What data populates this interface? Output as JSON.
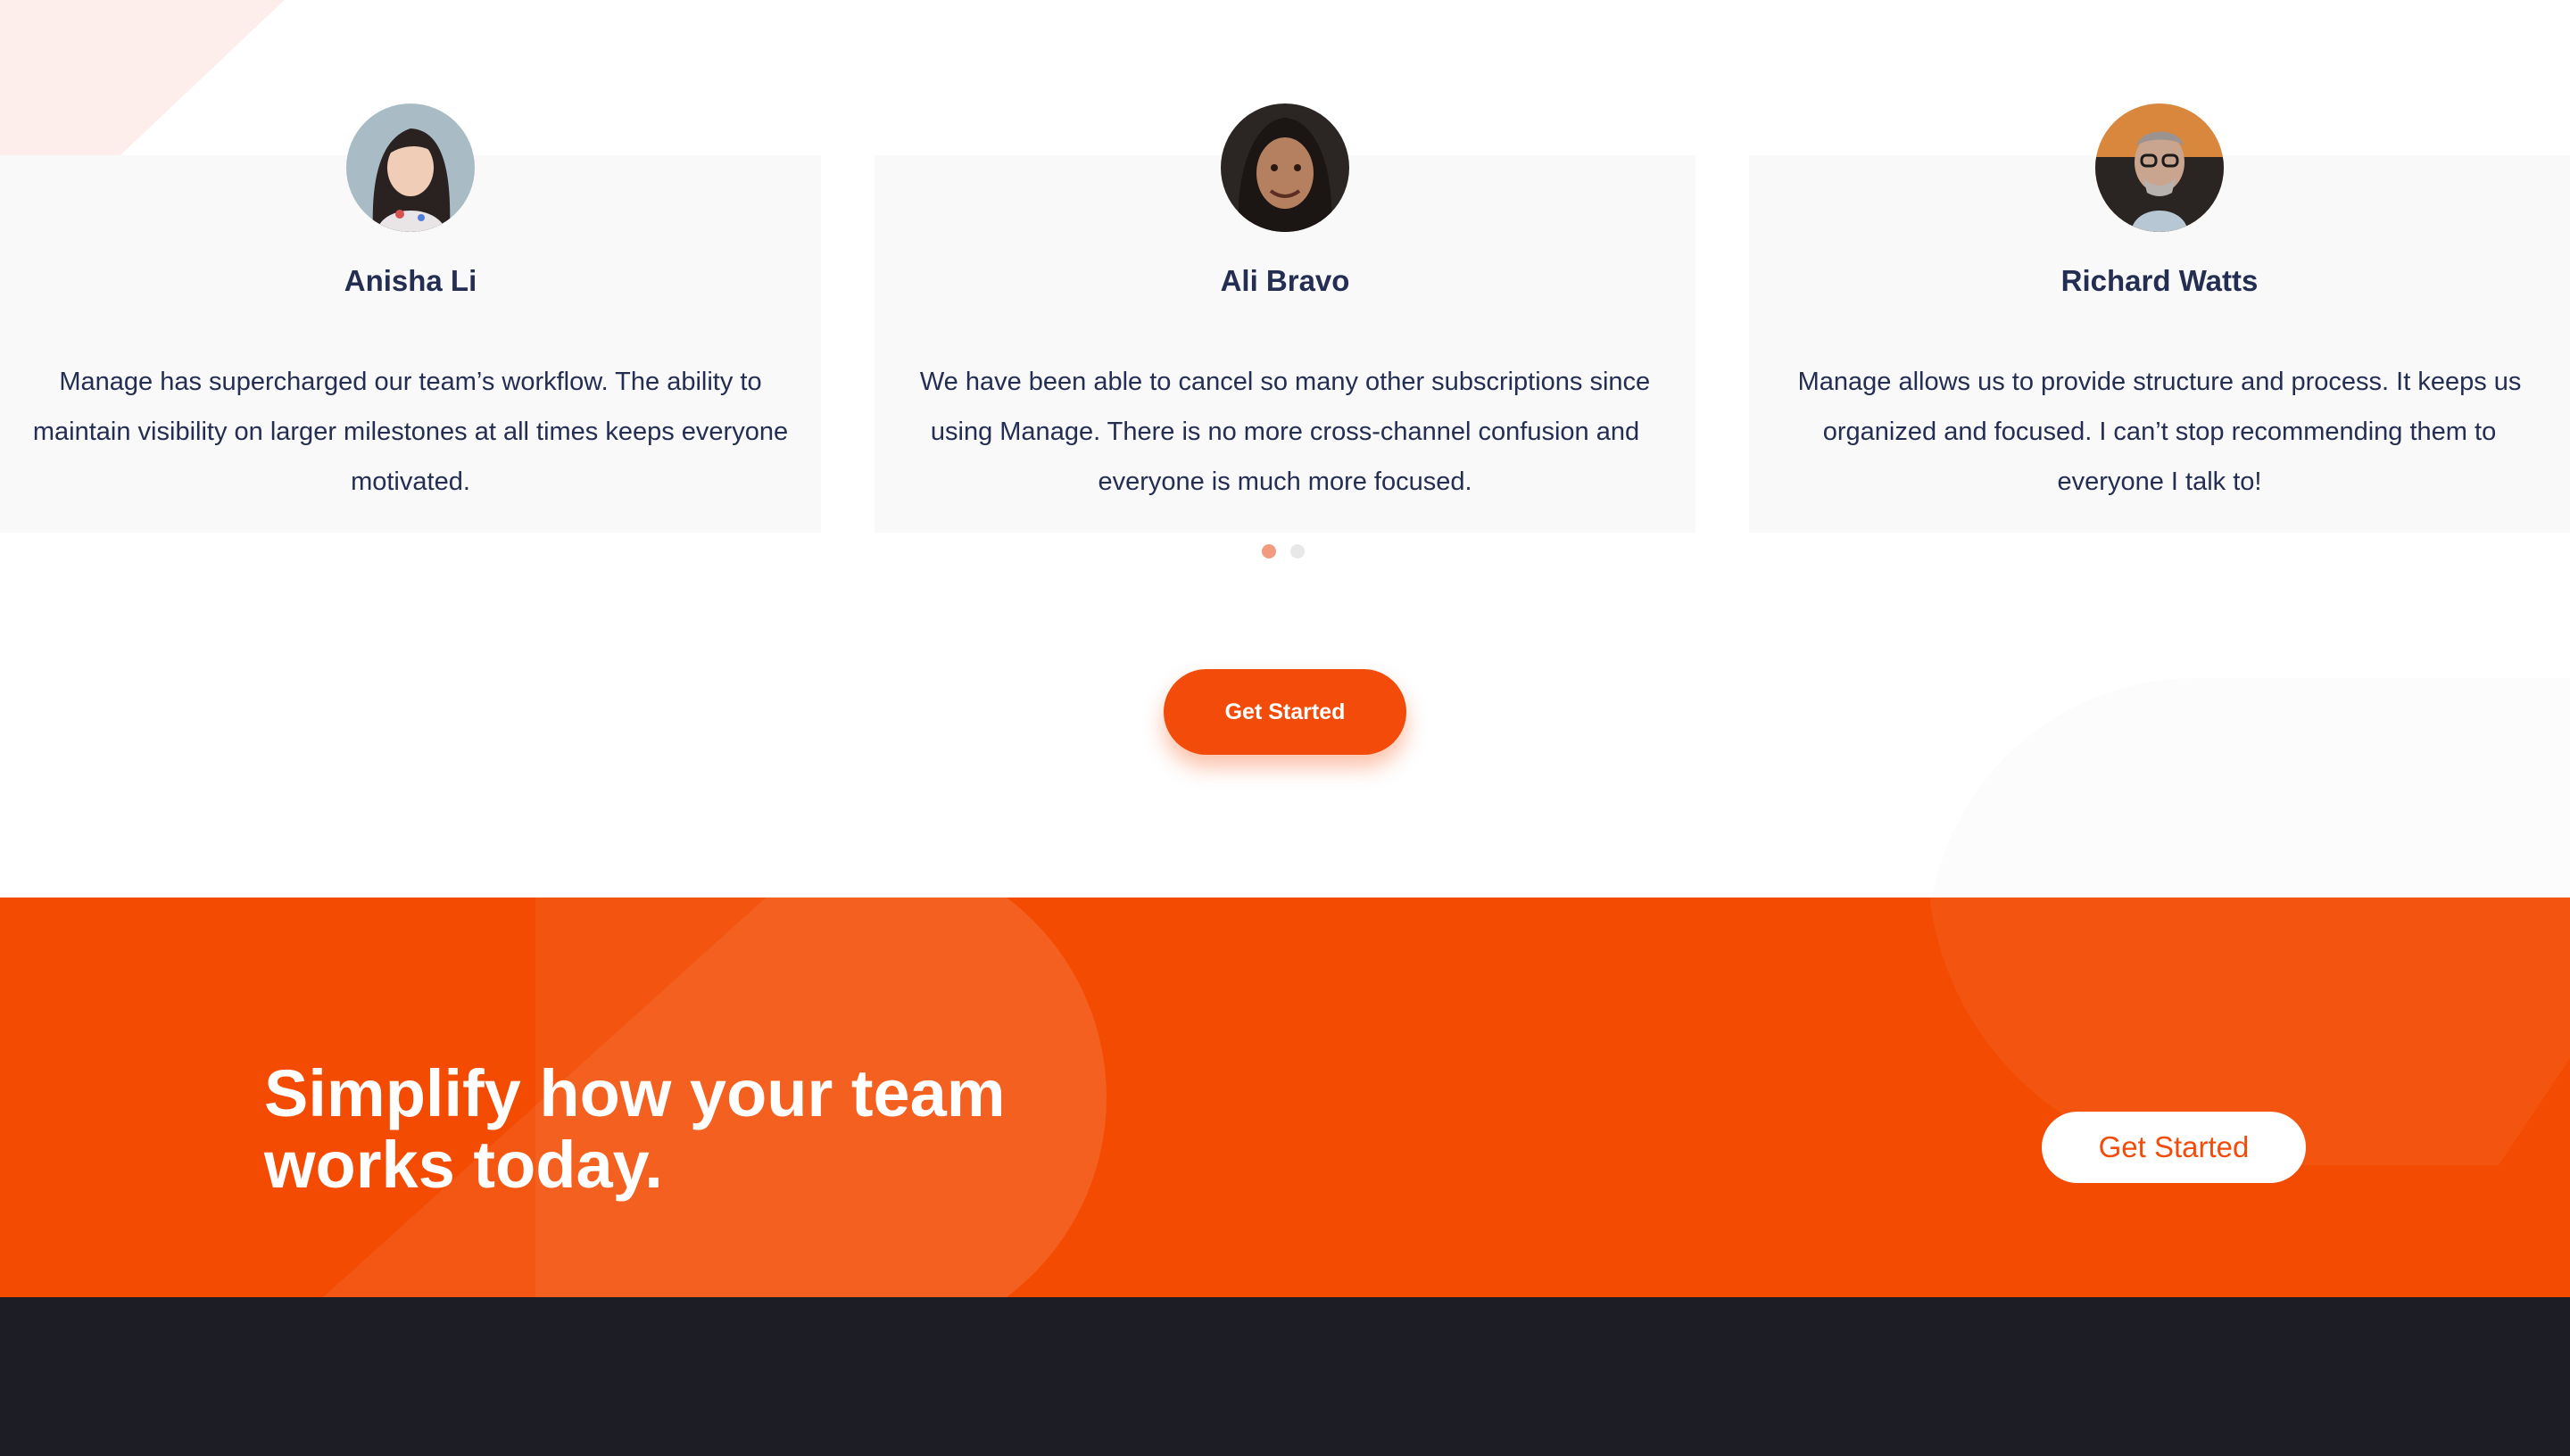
{
  "testimonials": [
    {
      "name": "Anisha Li",
      "quote": "Manage has supercharged our team’s workflow. The ability to maintain visibility on larger milestones at all times keeps everyone motivated."
    },
    {
      "name": "Ali Bravo",
      "quote": "We have been able to cancel so many other subscriptions since using Manage. There is no more cross-channel confusion and everyone is much more focused."
    },
    {
      "name": "Richard Watts",
      "quote": "Manage allows us to provide structure and process. It keeps us organized and focused. I can’t stop recommending them to everyone I talk to!"
    }
  ],
  "carousel": {
    "active_index": 0,
    "total_pages": 2
  },
  "primary_cta": {
    "label": "Get Started"
  },
  "banner": {
    "title": "Simplify how your team works today.",
    "button_label": "Get Started"
  },
  "colors": {
    "accent": "#f34c0a",
    "heading": "#242d52",
    "footer_bg": "#1d1e25",
    "card_bg": "#f9f9f9"
  }
}
